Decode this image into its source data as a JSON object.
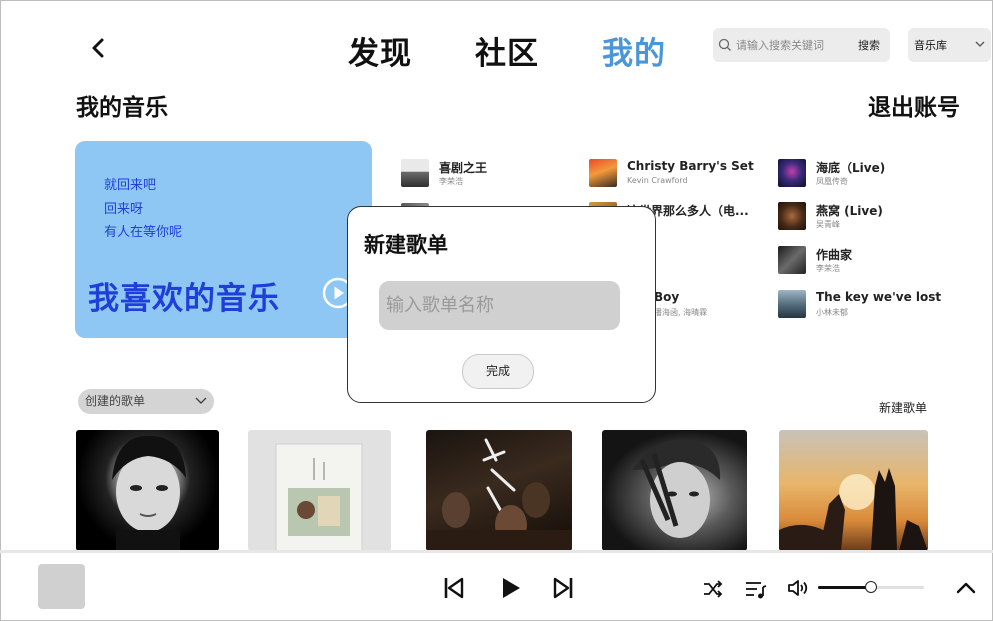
{
  "header": {
    "tabs": [
      {
        "label": "发现",
        "active": false
      },
      {
        "label": "社区",
        "active": false
      },
      {
        "label": "我的",
        "active": true
      }
    ],
    "search": {
      "placeholder": "请输入搜索关键词",
      "button": "搜索"
    },
    "library_select": "音乐库"
  },
  "my_music": {
    "title": "我的音乐",
    "logout": "退出账号",
    "favorites": {
      "lines": [
        "就回来吧",
        "回来呀",
        "有人在等你呢"
      ],
      "title": "我喜欢的音乐"
    },
    "songs": [
      {
        "name": "喜剧之王",
        "artist": "李荣浩"
      },
      {
        "name": "Christy Barry's Set",
        "artist": "Kevin Crawford"
      },
      {
        "name": "海底（Live)",
        "artist": "凤凰传奇"
      },
      {
        "name": "",
        "artist": ""
      },
      {
        "name": "这世界那么多人（电...",
        "artist": ""
      },
      {
        "name": "燕窝 (Live)",
        "artist": "吴青峰"
      },
      {
        "name": "",
        "artist": ""
      },
      {
        "name": "",
        "artist": ""
      },
      {
        "name": "作曲家",
        "artist": "李荣浩"
      },
      {
        "name": "Boy",
        "artist": "潘海函, 海晴霖"
      },
      {
        "name": "",
        "artist": ""
      },
      {
        "name": "The key we've lost",
        "artist": "小林未郁"
      }
    ]
  },
  "playlists": {
    "created_select": "创建的歌单",
    "new_playlist": "新建歌单"
  },
  "modal": {
    "title": "新建歌单",
    "input_placeholder": "输入歌单名称",
    "done": "完成"
  },
  "player": {
    "volume_level": 0.5
  },
  "colors": {
    "accent": "#4a96d8",
    "favorites_bg": "#8ec7f3",
    "favorites_text": "#1f3fd8"
  }
}
